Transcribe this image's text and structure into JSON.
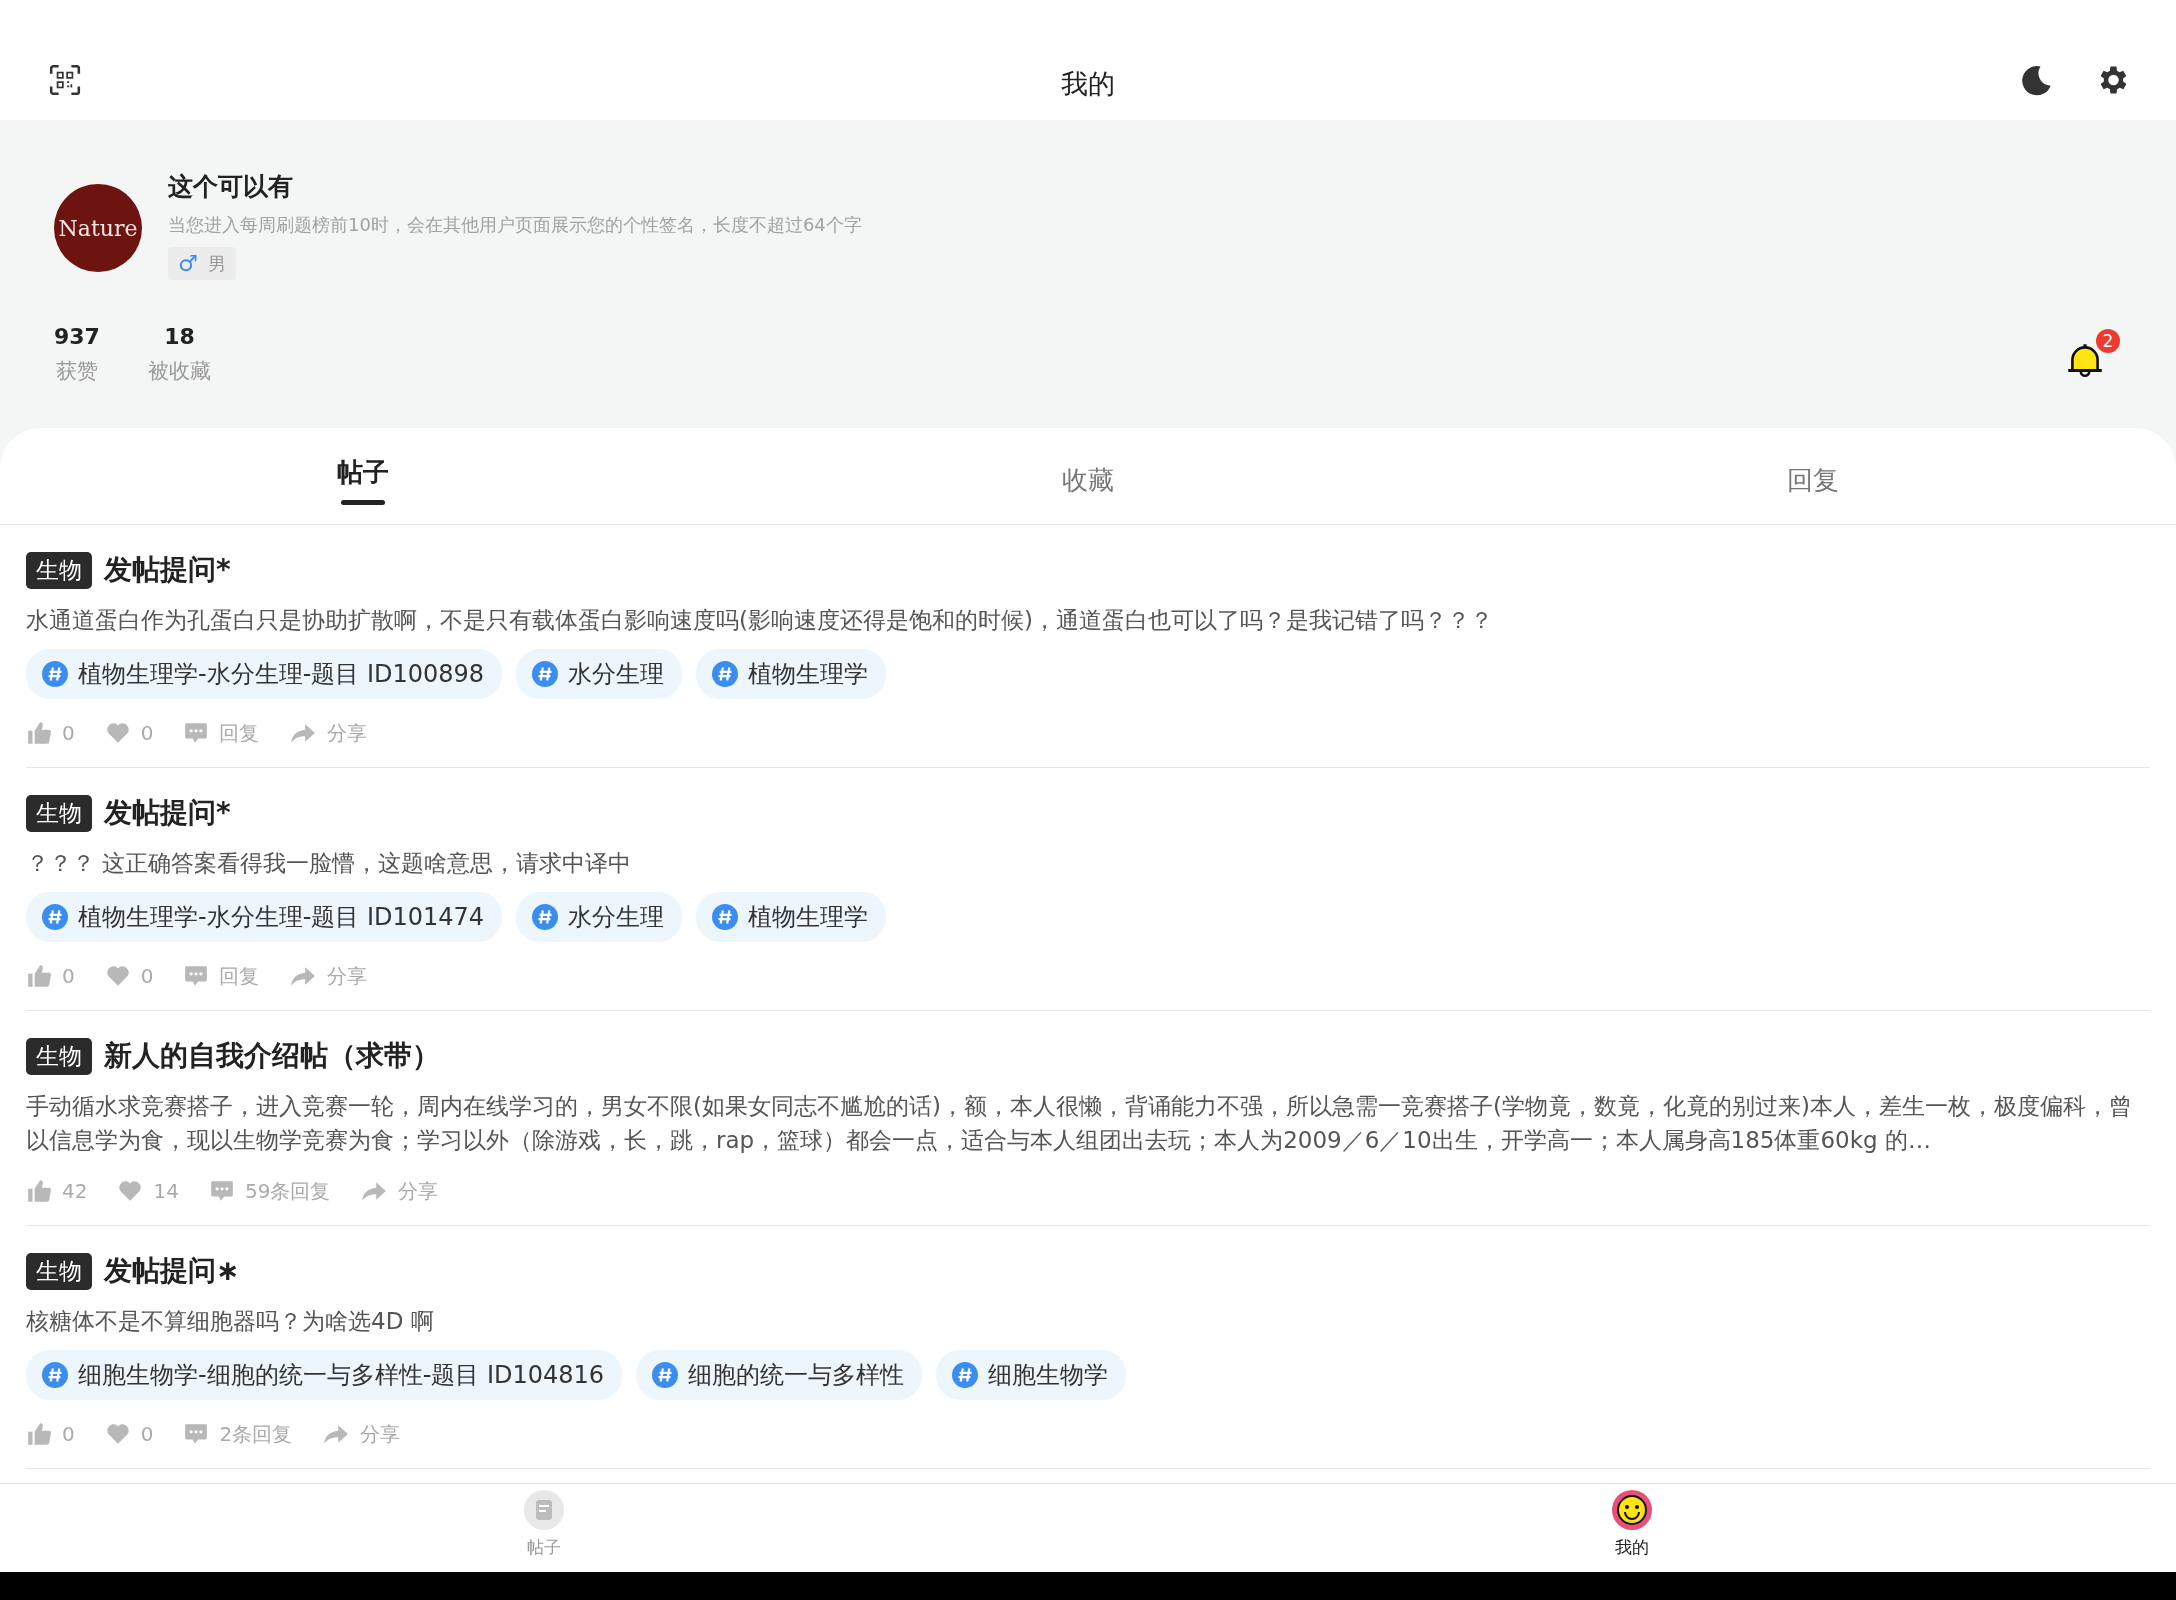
{
  "header": {
    "title": "我的"
  },
  "profile": {
    "avatar_text": "Nature",
    "name": "这个可以有",
    "signature": "当您进入每周刷题榜前10时，会在其他用户页面展示您的个性签名，长度不超过64个字",
    "gender": {
      "symbol": "♂",
      "label": "男"
    },
    "stats": [
      {
        "value": "937",
        "label": "获赞"
      },
      {
        "value": "18",
        "label": "被收藏"
      }
    ],
    "notification_badge": "2"
  },
  "tabs": [
    {
      "label": "帖子",
      "selected": true
    },
    {
      "label": "收藏",
      "selected": false
    },
    {
      "label": "回复",
      "selected": false
    }
  ],
  "posts": [
    {
      "category": "生物",
      "title": "发帖提问*",
      "body": "水通道蛋白作为孔蛋白只是协助扩散啊，不是只有载体蛋白影响速度吗(影响速度还得是饱和的时候)，通道蛋白也可以了吗？是我记错了吗？？？",
      "topics": [
        "植物生理学-水分生理-题目 ID100898",
        "水分生理",
        "植物生理学"
      ],
      "likes": "0",
      "favorites": "0",
      "replies": "回复",
      "share": "分享"
    },
    {
      "category": "生物",
      "title": "发帖提问*",
      "body": "？？？ 这正确答案看得我一脸懵，这题啥意思，请求中译中",
      "topics": [
        "植物生理学-水分生理-题目 ID101474",
        "水分生理",
        "植物生理学"
      ],
      "likes": "0",
      "favorites": "0",
      "replies": "回复",
      "share": "分享"
    },
    {
      "category": "生物",
      "title": "新人的自我介绍帖（求带）",
      "body": "手动循水求竞赛搭子，进入竞赛一轮，周内在线学习的，男女不限(如果女同志不尴尬的话)，额，本人很懒，背诵能力不强，所以急需一竞赛搭子(学物竟，数竟，化竟的别过来)本人，差生一枚，极度偏科，曾以信息学为食，现以生物学竞赛为食；学习以外（除游戏，长，跳，rap，篮球）都会一点，适合与本人组团出去玩；本人为2009／6／10出生，开学高一；本人属身高185体重60kg 的…",
      "likes": "42",
      "favorites": "14",
      "replies": "59条回复",
      "share": "分享"
    },
    {
      "category": "生物",
      "title": "发帖提问∗",
      "body": "核糖体不是不算细胞器吗？为啥选4D 啊",
      "topics": [
        "细胞生物学-细胞的统一与多样性-题目 ID104816",
        "细胞的统一与多样性",
        "细胞生物学"
      ],
      "likes": "0",
      "favorites": "0",
      "replies": "2条回复",
      "share": "分享"
    }
  ],
  "bottom_nav": [
    {
      "label": "帖子",
      "selected": false
    },
    {
      "label": "我的",
      "selected": true
    }
  ]
}
